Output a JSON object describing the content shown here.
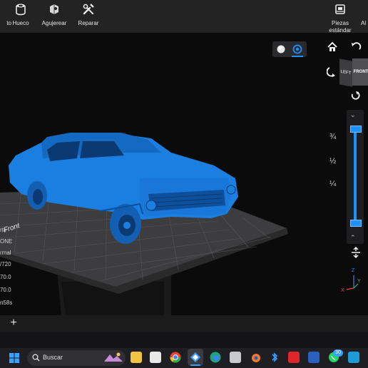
{
  "toolbar": {
    "items": [
      {
        "label": "to",
        "icon": "cut-icon"
      },
      {
        "label": "Hueco",
        "icon": "hollow-cylinder-icon"
      },
      {
        "label": "Agujerear",
        "icon": "drill-hole-icon"
      },
      {
        "label": "Reparar",
        "icon": "repair-tools-icon"
      },
      {
        "label": "Piezas",
        "label2": "estándar",
        "icon": "standard-parts-icon"
      },
      {
        "label": "Al",
        "icon": "align-icon"
      }
    ]
  },
  "viewcube": {
    "left_label": "LEFT",
    "front_label": "FRONT"
  },
  "layer_slider": {
    "ticks": [
      "¾",
      "½",
      "¼"
    ],
    "top_value": 1.0,
    "bottom_value": 0.0
  },
  "build_plate": {
    "label": "Front"
  },
  "info_panel": {
    "rows": [
      "rte",
      "ONE",
      "rmal",
      "/720",
      "70.0",
      "70.0",
      "n58s"
    ]
  },
  "axes": {
    "z": "Z",
    "y": "Y",
    "x": "X"
  },
  "taskbar": {
    "search_placeholder": "Buscar",
    "notification_count": "30",
    "apps": [
      "start-icon",
      "file-explorer-icon",
      "store-icon",
      "chrome-icon",
      "app-icon",
      "edge-icon",
      "calculator-icon",
      "blender-icon",
      "bluetooth-icon",
      "pdf-icon",
      "word-icon",
      "whatsapp-icon",
      "notes-icon"
    ]
  },
  "colors": {
    "model": "#1a7fe0",
    "accent": "#1e90ff",
    "toolbar": "#232323"
  }
}
